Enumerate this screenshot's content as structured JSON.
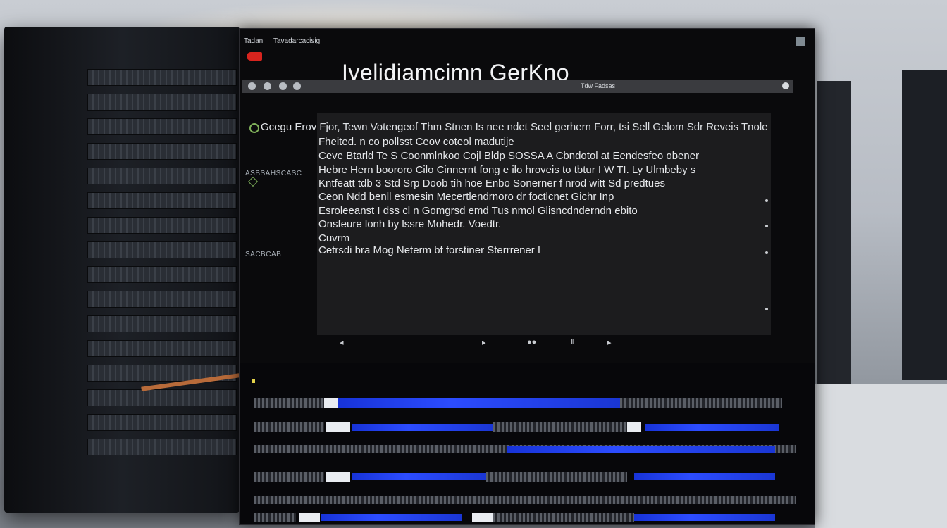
{
  "window": {
    "tab_left": "Tadan",
    "tab_right": "Tavadarcacisig",
    "app_title": "Ivelidiamcimn GerKno"
  },
  "toolbar": {
    "label": "Tdw  Fadsas"
  },
  "sidebar": {
    "item1": "ASBSAHSCASC",
    "item2": "SACBCAB"
  },
  "main": {
    "lines": [
      "Gcegu Erov Fjor, Tewn Votengeof Thm Stnen Is nee ndet Seel gerhern Forr, tsi Sell Gelom Sdr Reveis Tnole",
      "Fheited. n co pollsst  Ceov coteol madutije",
      "Ceve Btarld Te S Coonmlnkoo Cojl Bldp SOSSA A Cbndotol at Eendesfeo obener",
      "Hebre Hern boororo Cilo Cinnernt fong e ilo  hroveis to tbtur I W TI. Ly Ulmbeby s",
      "Kntfeatt tdb 3 Std Srp Doob tih hoe Enbo Sonerner f nrod witt Sd predtues",
      "Ceon Ndd benll esmesin Mecertlendrnoro dr foctlcnet Gichr Inp",
      "Esroleeanst I dss cl n Gomgrsd emd Tus nmol Glisncdnderndn ebito",
      "Onsfeure lonh by lssre Mohedr. Voedtr.",
      "Cuvrm",
      "Cetrsdi bra Mog Neterm bf forstiner Sterrrener I"
    ]
  },
  "colors": {
    "accent_blue": "#2c4cff",
    "title_red": "#d8241e",
    "panel": "#1c1c1e"
  }
}
